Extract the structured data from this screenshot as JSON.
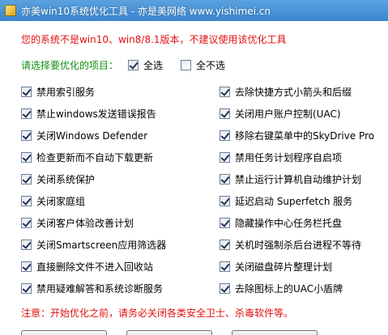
{
  "window": {
    "title": "亦美win10系统优化工具 - 亦是美网络 www.yishimei.cn"
  },
  "warning_text": "您的系统不是win10、win8/8.1版本，不建议使用该优化工具",
  "select_prompt": "请选择要优化的项目：",
  "select_all": {
    "label": "全选",
    "checked": true
  },
  "select_none": {
    "label": "全不选",
    "checked": false
  },
  "options_left": [
    {
      "label": "禁用索引服务",
      "checked": true
    },
    {
      "label": "禁止windows发送错误报告",
      "checked": true
    },
    {
      "label": "关闭Windows Defender",
      "checked": true
    },
    {
      "label": "检查更新而不自动下载更新",
      "checked": true
    },
    {
      "label": "关闭系统保护",
      "checked": true
    },
    {
      "label": "关闭家庭组",
      "checked": true
    },
    {
      "label": "关闭客户体验改善计划",
      "checked": true
    },
    {
      "label": "关闭Smartscreen应用筛选器",
      "checked": true
    },
    {
      "label": "直接删除文件不进入回收站",
      "checked": true
    },
    {
      "label": "禁用疑难解答和系统诊断服务",
      "checked": true
    }
  ],
  "options_right": [
    {
      "label": "去除快捷方式小箭头和后缀",
      "checked": true
    },
    {
      "label": "关闭用户账户控制(UAC)",
      "checked": true
    },
    {
      "label": "移除右键菜单中的SkyDrive Pro",
      "checked": true
    },
    {
      "label": "禁用任务计划程序自启项",
      "checked": true
    },
    {
      "label": "禁止运行计算机自动维护计划",
      "checked": true
    },
    {
      "label": "延迟启动 Superfetch 服务",
      "checked": true
    },
    {
      "label": "隐藏操作中心任务栏托盘",
      "checked": true
    },
    {
      "label": "关机时强制杀后台进程不等待",
      "checked": true
    },
    {
      "label": "关闭磁盘碎片整理计划",
      "checked": true
    },
    {
      "label": "去除图标上的UAC小盾牌",
      "checked": true
    }
  ],
  "note_text": "注意：开始优化之前，请务必关闭各类安全卫士、杀毒软件等。",
  "colors": {
    "titlebar": "#3a86cf",
    "warning": "#e01010",
    "prompt": "#109010"
  }
}
